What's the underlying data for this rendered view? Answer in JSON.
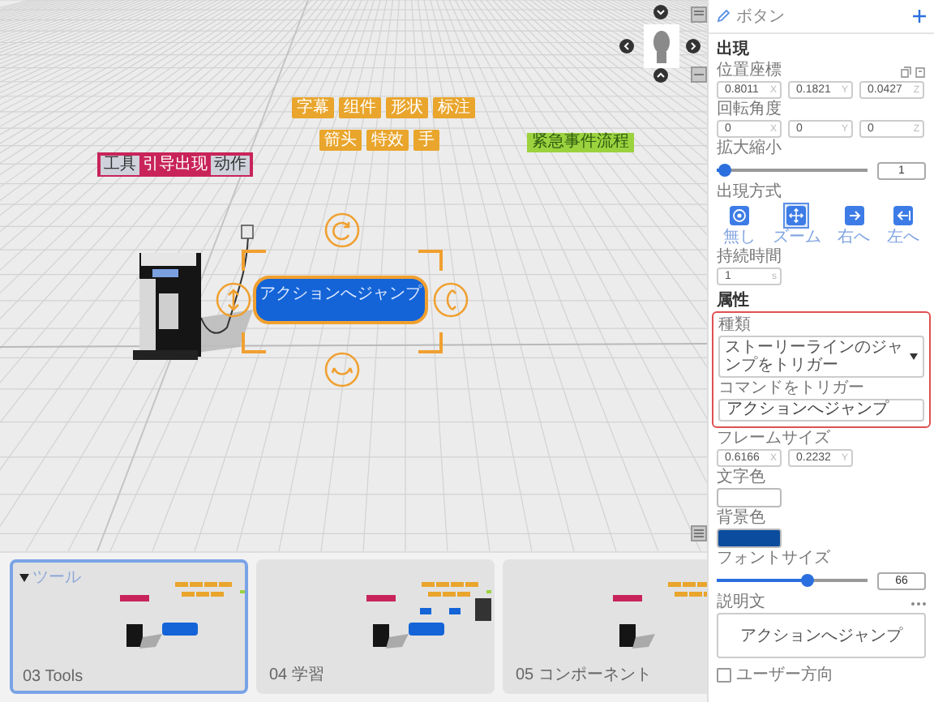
{
  "scene": {
    "tag_rows": [
      [
        "字幕",
        "组件",
        "形状",
        "标注"
      ],
      [
        "箭头",
        "特效",
        "手"
      ]
    ],
    "pink_bar": {
      "chips": [
        "工具",
        "引导出现",
        "动作"
      ]
    },
    "green_label": "紧急事件流程",
    "selected_button": {
      "label": "アクションへジャンプ"
    }
  },
  "filmstrip": {
    "cards": [
      {
        "label": "03 Tools",
        "heading": "ツール",
        "selected": true
      },
      {
        "label": "04 学習",
        "selected": false
      },
      {
        "label": "05 コンポーネント",
        "selected": false
      }
    ]
  },
  "panel": {
    "title": "ボタン",
    "appearance": {
      "title": "出現",
      "position": {
        "label": "位置座標",
        "values": [
          {
            "value": "0.8011",
            "axis": "X"
          },
          {
            "value": "0.1821",
            "axis": "Y"
          },
          {
            "value": "0.0427",
            "axis": "Z"
          }
        ]
      },
      "rotation": {
        "label": "回転角度",
        "values": [
          {
            "value": "0",
            "axis": "X"
          },
          {
            "value": "0",
            "axis": "Y"
          },
          {
            "value": "0",
            "axis": "Z"
          }
        ]
      },
      "scale": {
        "label": "拡大縮小",
        "level": 0.05,
        "value": "1"
      },
      "mode": {
        "label": "出現方式",
        "options": [
          {
            "label": "無し",
            "kind": "none",
            "selected": false
          },
          {
            "label": "ズーム",
            "kind": "zoom",
            "selected": true
          },
          {
            "label": "右へ",
            "kind": "right",
            "selected": false
          },
          {
            "label": "左へ",
            "kind": "left",
            "selected": false
          }
        ]
      },
      "duration": {
        "label": "持続時間",
        "value": "1",
        "unit": "s"
      }
    },
    "attributes": {
      "title": "属性",
      "type": {
        "label": "種類",
        "value": "ストーリーラインのジャンプをトリガー"
      },
      "command": {
        "label": "コマンドをトリガー",
        "value": "アクションへジャンプ"
      },
      "frame_size": {
        "label": "フレームサイズ",
        "values": [
          {
            "value": "0.6166",
            "axis": "X"
          },
          {
            "value": "0.2232",
            "axis": "Y"
          }
        ]
      },
      "text_color": {
        "label": "文字色",
        "color": "#ffffff"
      },
      "background_color": {
        "label": "背景色",
        "color": "#0b4c9e"
      },
      "font_size": {
        "label": "フォントサイズ",
        "level": 0.6,
        "value": "66"
      },
      "description": {
        "label": "説明文",
        "value": "アクションへジャンプ"
      },
      "user_facing": {
        "label": "ユーザー方向",
        "checked": false
      }
    }
  }
}
